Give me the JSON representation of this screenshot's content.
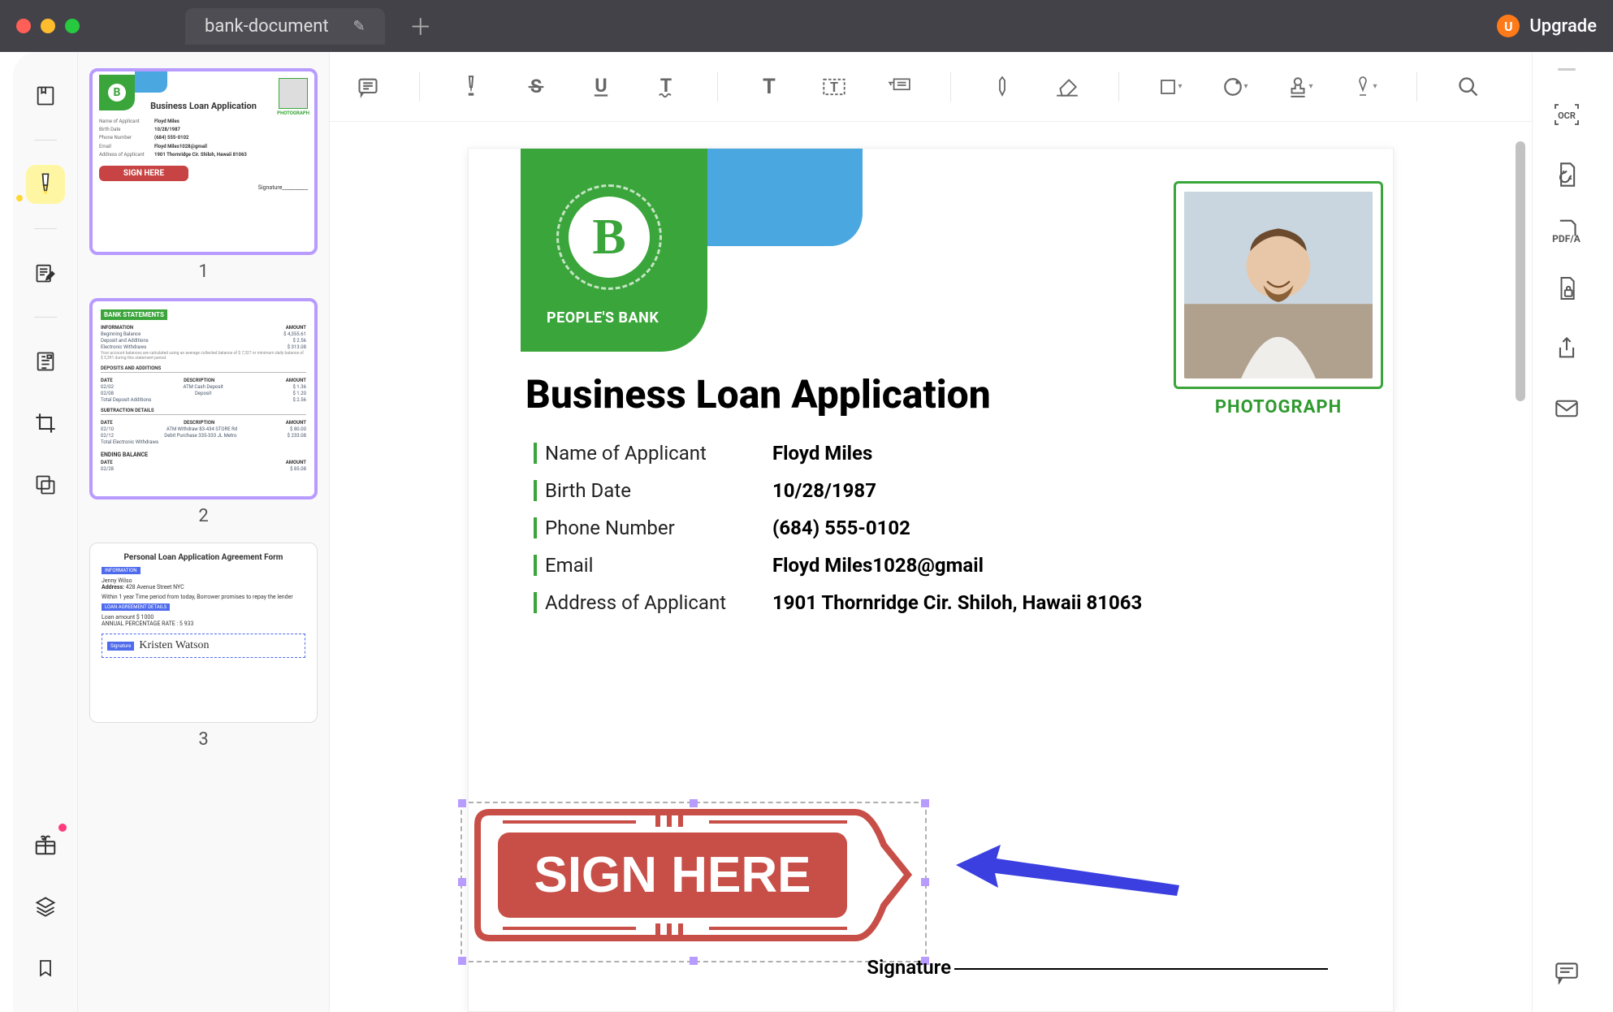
{
  "titlebar": {
    "tab_name": "bank-document",
    "upgrade_label": "Upgrade",
    "upgrade_badge": "U"
  },
  "thumbs": {
    "p1": {
      "num": "1",
      "title": "Business Loan Application",
      "photo_lbl": "PHOTOGRAPH",
      "rows": [
        {
          "k": "Name of Applicant",
          "v": "Floyd Miles"
        },
        {
          "k": "Birth Date",
          "v": "10/28/1987"
        },
        {
          "k": "Phone Number",
          "v": "(684) 555-0102"
        },
        {
          "k": "Email",
          "v": "Floyd Miles1028@gmail"
        },
        {
          "k": "Address of Applicant",
          "v": "1901 Thornridge Cir. Shiloh, Hawaii 81063"
        }
      ],
      "sign": "SIGN HERE",
      "sigline": "Signature__________"
    },
    "p2": {
      "num": "2",
      "title": "BANK STATEMENTS",
      "col_a": "INFORMATION",
      "col_b": "AMOUNT",
      "begin": "Beginning Balance",
      "sect_dep": "DEPOSITS AND ADDITIONS",
      "sect_sub": "SUBTRACTION DETAILS",
      "total_dep": "Total Deposit Additions",
      "total_elec": "Total Electronic Withdraws",
      "end": "ENDING BALANCE",
      "date": "DATE",
      "desc": "DESCRIPTION",
      "amt": "AMOUNT"
    },
    "p3": {
      "num": "3",
      "title": "Personal Loan Application Agreement Form",
      "info": "INFORMATION",
      "name": "Jenny Wilso",
      "addr_lbl": "Address:",
      "addr": "428 Avenue Street NYC",
      "line": "Within 1 year Time period from today, Borrower promises to repay the lender",
      "loan": "LOAN AGREEMENT DETAILS",
      "loan_amount": "Loan amount $ 1000",
      "apr": "ANNUAL PERCENTAGE RATE : 5 933",
      "sig_btn": "Signature",
      "sig_name": "Kristen Watson"
    }
  },
  "toolbar": {
    "comment": "comment",
    "highlighter": "highlighter",
    "strike": "S",
    "underline": "U",
    "squiggly": "T",
    "text": "T",
    "textbox": "textbox",
    "callout": "callout",
    "pen": "pen",
    "eraser": "eraser",
    "shape": "shape",
    "circle": "circle",
    "stamp": "stamp",
    "sign": "sign",
    "search": "search"
  },
  "document": {
    "bank_name": "PEOPLE'S BANK",
    "logo_letter": "B",
    "title": "Business Loan Application",
    "photo_label": "PHOTOGRAPH",
    "fields": [
      {
        "k": "Name of Applicant",
        "v": "Floyd Miles"
      },
      {
        "k": "Birth Date",
        "v": "10/28/1987"
      },
      {
        "k": "Phone Number",
        "v": "(684) 555-0102"
      },
      {
        "k": "Email",
        "v": "Floyd Miles1028@gmail"
      },
      {
        "k": "Address of Applicant",
        "v": "1901 Thornridge Cir. Shiloh, Hawaii 81063"
      }
    ],
    "stamp_text": "SIGN HERE",
    "signature_label": "Signature"
  },
  "right_rail": {
    "ocr": "OCR",
    "pdfa": "PDF/A"
  }
}
